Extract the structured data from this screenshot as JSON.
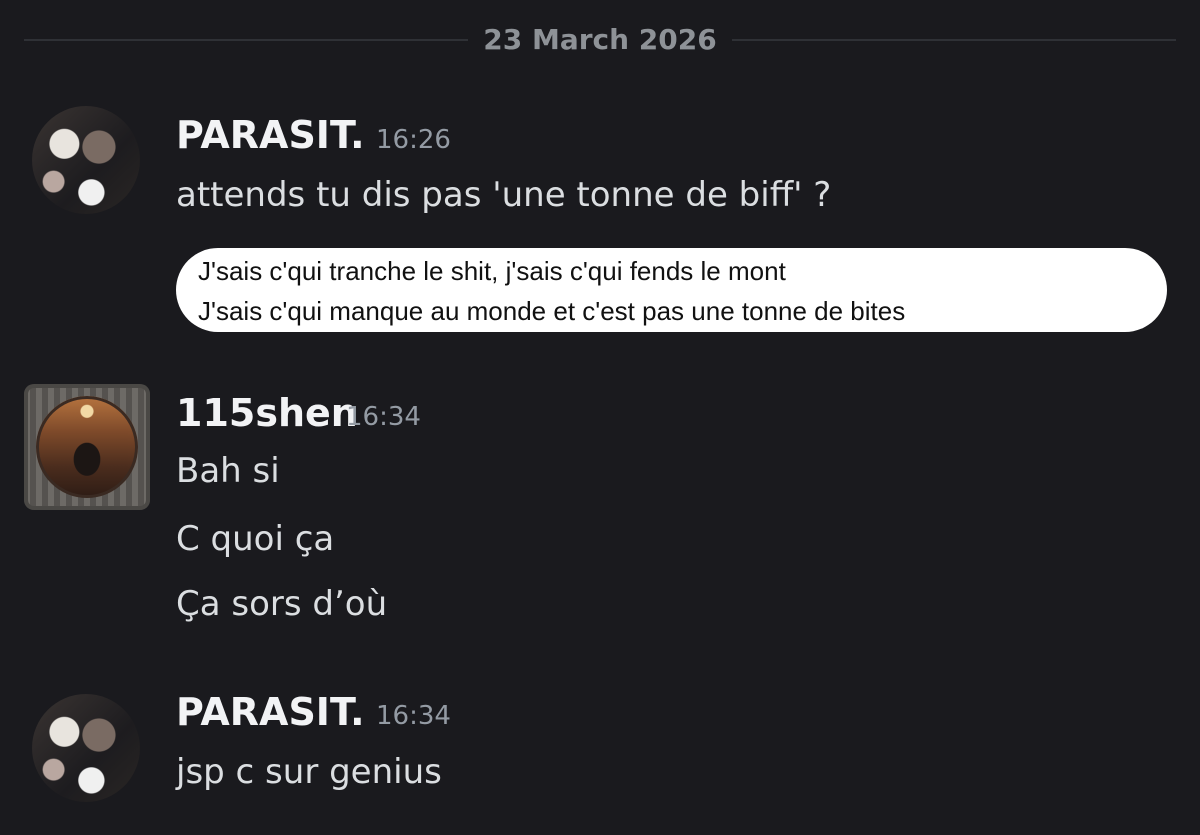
{
  "date_divider": "23 March 2026",
  "messages": [
    {
      "author": "PARASIT.",
      "time": "16:26",
      "lines": [
        "attends tu dis pas 'une tonne de biff' ?"
      ],
      "attachment": {
        "type": "image",
        "lines": [
          "J'sais c'qui tranche le shit, j'sais c'qui fends le mont",
          "J'sais c'qui manque au monde et c'est pas une tonne de bites"
        ]
      }
    },
    {
      "author": "115shen",
      "time": "16:34",
      "lines": [
        "Bah si",
        "C quoi ça",
        "Ça sors d’où"
      ]
    },
    {
      "author": "PARASIT.",
      "time": "16:34",
      "lines": [
        "jsp c sur genius"
      ]
    }
  ]
}
